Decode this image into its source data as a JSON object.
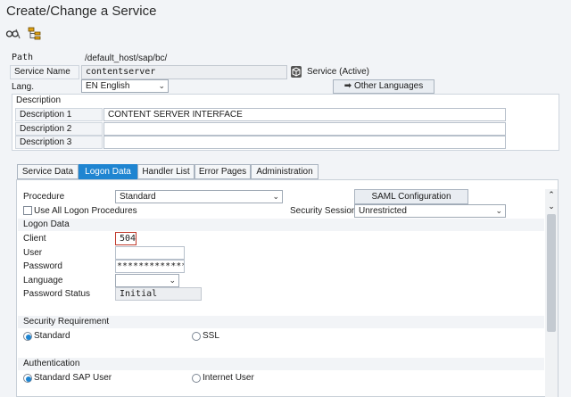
{
  "window": {
    "title": "Create/Change a Service"
  },
  "toolbar": {
    "icons": [
      "glasses-pencil-icon",
      "hierarchy-icon"
    ]
  },
  "header": {
    "path_label": "Path",
    "path_value": "/default_host/sap/bc/",
    "service_name_label": "Service Name",
    "service_name_value": "contentserver",
    "service_status": "Service (Active)",
    "lang_label": "Lang.",
    "lang_value": "EN English",
    "other_languages_label": "Other Languages"
  },
  "description": {
    "title": "Description",
    "rows": [
      {
        "label": "Description 1",
        "value": "CONTENT SERVER INTERFACE"
      },
      {
        "label": "Description 2",
        "value": ""
      },
      {
        "label": "Description 3",
        "value": ""
      }
    ]
  },
  "tabs": [
    {
      "label": "Service Data",
      "active": false
    },
    {
      "label": "Logon Data",
      "active": true
    },
    {
      "label": "Handler List",
      "active": false
    },
    {
      "label": "Error Pages",
      "active": false
    },
    {
      "label": "Administration",
      "active": false
    }
  ],
  "logon": {
    "procedure_label": "Procedure",
    "procedure_value": "Standard",
    "saml_button": "SAML Configuration",
    "use_all_label": "Use All Logon Procedures",
    "security_session_label": "Security Session:",
    "security_session_value": "Unrestricted",
    "logon_data_title": "Logon Data",
    "client_label": "Client",
    "client_value": "504",
    "user_label": "User",
    "user_value": "",
    "password_label": "Password",
    "password_value": "**************",
    "language_label": "Language",
    "language_value": "",
    "password_status_label": "Password Status",
    "password_status_value": "Initial"
  },
  "security_requirement": {
    "title": "Security Requirement",
    "standard_label": "Standard",
    "ssl_label": "SSL",
    "selected": "Standard"
  },
  "authentication": {
    "title": "Authentication",
    "standard_sap_user_label": "Standard SAP User",
    "internet_user_label": "Internet User",
    "selected": "Standard SAP User"
  },
  "colors": {
    "accent": "#1f85d1",
    "background": "#f2f4f7"
  }
}
